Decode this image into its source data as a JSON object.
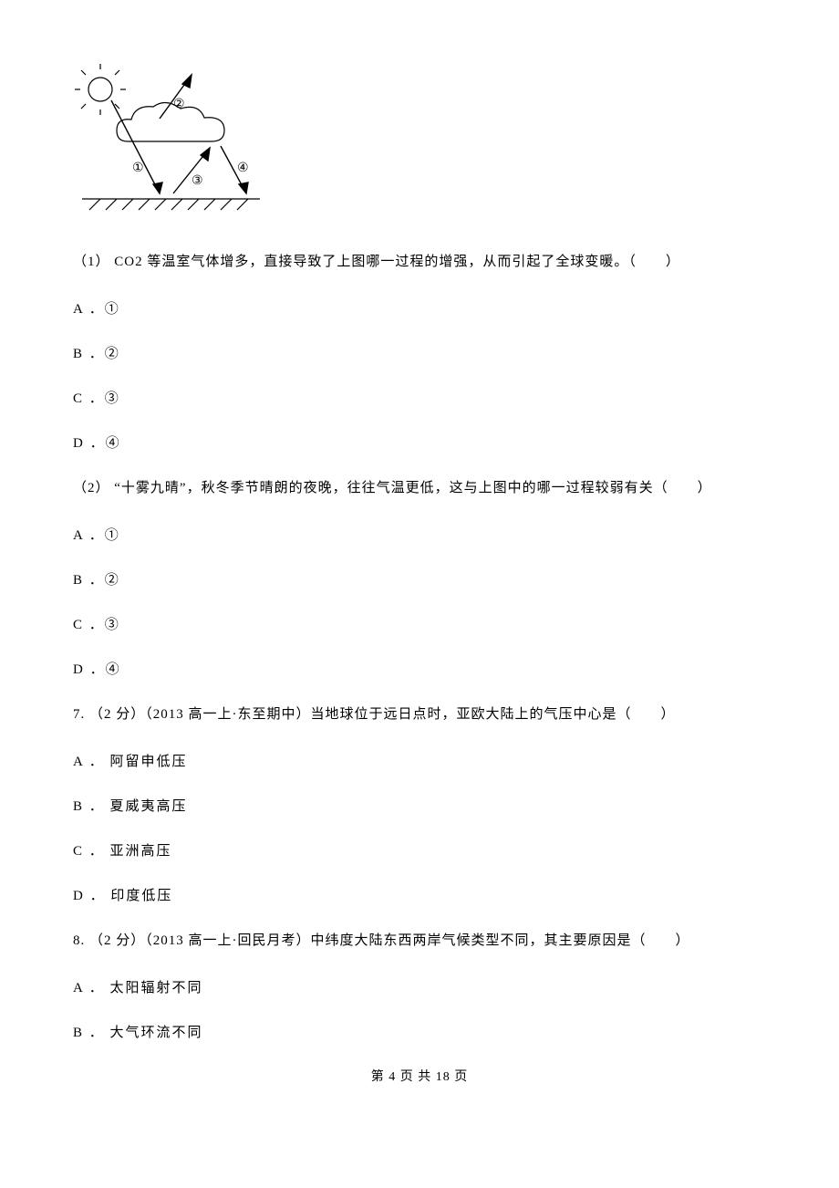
{
  "q1": {
    "stem": "（1）  CO2 等温室气体增多，直接导致了上图哪一过程的增强，从而引起了全球变暖。（　　）",
    "optA": "A ．①",
    "optB": "B ．②",
    "optC": "C ．③",
    "optD": "D ．④"
  },
  "q2": {
    "stem": "（2） “十雾九晴”，秋冬季节晴朗的夜晚，往往气温更低，这与上图中的哪一过程较弱有关（　　）",
    "optA": "A ．①",
    "optB": "B ．②",
    "optC": "C ．③",
    "optD": "D ．④"
  },
  "q7": {
    "stem": "7. （2 分）（2013 高一上·东至期中）当地球位于远日点时，亚欧大陆上的气压中心是（　　）",
    "optA": "A ． 阿留申低压",
    "optB": "B ． 夏威夷高压",
    "optC": "C ． 亚洲高压",
    "optD": "D ． 印度低压"
  },
  "q8": {
    "stem": "8. （2 分）（2013 高一上·回民月考）中纬度大陆东西两岸气候类型不同，其主要原因是（　　）",
    "optA": "A ． 太阳辐射不同",
    "optB": "B ． 大气环流不同"
  },
  "footer": "第 4 页 共 18 页"
}
